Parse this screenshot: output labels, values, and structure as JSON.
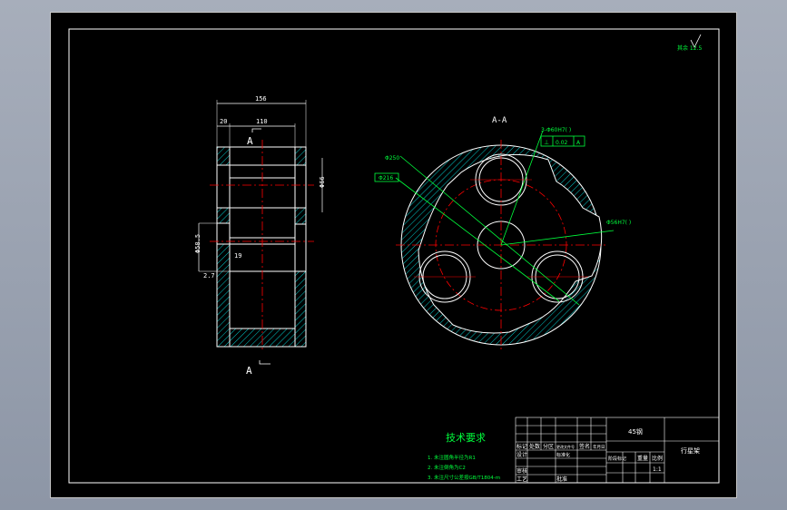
{
  "drawing": {
    "dims": {
      "width_overall": "156",
      "width_inner": "110",
      "left_offset": "20",
      "bore_dia": "Φ66",
      "hub_dia": "Φ58.5",
      "gap": "19",
      "step": "2.7"
    },
    "section_label": "A",
    "view_label": "A-A",
    "callouts": {
      "hole_3": "3-Φ60H7( )",
      "tol_frame_symbol": "⊥",
      "tol_frame_value": "0.02",
      "tol_frame_datum": "A",
      "dia_outer": "Φ250",
      "dia_pcd": "Φ216",
      "bore_center": "Φ56H7( )"
    },
    "roughness": "其余 12.5"
  },
  "tech_req": {
    "title": "技术要求",
    "items": [
      "1. 未注圆角半径为R1",
      "2. 未注倒角为C2",
      "3. 未注尺寸公差按GB/T1804-m"
    ]
  },
  "title_block": {
    "material": "45钢",
    "part_name": "行星架",
    "labels": [
      "标记",
      "处数",
      "分区",
      "更改文件号",
      "签名",
      "年月日",
      "设计",
      "标准化",
      "阶段标记",
      "重量",
      "比例",
      "审核",
      "工艺",
      "批准"
    ],
    "scale": "1:1"
  },
  "colors": {
    "background": "#000000",
    "outline": "#ffffff",
    "center_line": "#ff0000",
    "hatch": "#00c8c8",
    "dimension": "#00ff3c",
    "text": "#ffffff"
  }
}
